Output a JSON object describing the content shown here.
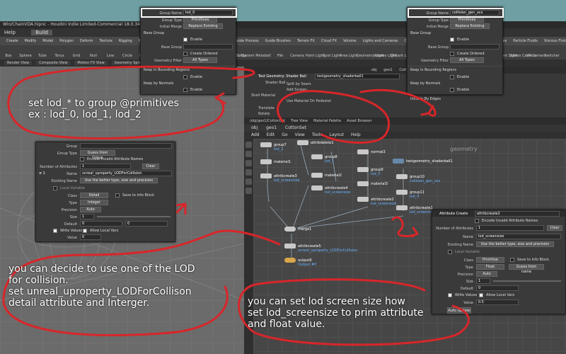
{
  "window": {
    "title": "Win/ChainVDA.hipnc - Houdini Indie Limited-Commercial 18.0.348",
    "menu": [
      "Help",
      "Build"
    ]
  },
  "shelf_tabs": [
    "Create",
    "Modify",
    "Model",
    "Polygon",
    "Deform",
    "Texture",
    "Rigging",
    "Muscles",
    "Characters",
    "Constraints",
    "Hair Utils",
    "Guide Process",
    "Guide Brushes",
    "Terrain FX",
    "Cloud FX",
    "Volume",
    "Lights and Cameras",
    "Collisions",
    "Particles",
    "Grains",
    "Vellum",
    "Rigid Bodies",
    "Particle Fluids",
    "Viscous Fluids",
    "Oceans",
    "Fluid Containers",
    "Populate Containers",
    "Container Tools",
    "Pyro FX",
    "Sparse Pyro FX",
    "FEM",
    "Wires",
    "Crowds",
    "Drive Simulation"
  ],
  "tool_labels": [
    "Box",
    "Sphere",
    "Tube",
    "Torus",
    "Grid",
    "Null",
    "Line",
    "Circle",
    "Curve",
    "Draw Curve",
    "Path",
    "Spray Paint",
    "Font",
    "Platonic Solids",
    "L-System",
    "Metaball",
    "File"
  ],
  "light_tools": [
    "Camera",
    "Point Light",
    "Spot Light",
    "Area Light",
    "Geometry Light",
    "Volume Light",
    "Distant Light",
    "Environment Light",
    "Sky Light",
    "GI Light",
    "Caustic Light",
    "Portal Light",
    "Ambient Light",
    "Stereo Camera",
    "VR Camera",
    "Switcher"
  ],
  "pane_tabs": [
    "Render View",
    "Composite View",
    "Motion FX View",
    "Geometry Spreadsheet",
    "Take List",
    "Performance Monitor"
  ],
  "param_header": {
    "node_type": "Test Geometry: Shader Ball",
    "node_name": "testgeometry_shaderball1",
    "rows": [
      "Shader Ball",
      "Split by Seam",
      "Add Screws",
      "Shell Material",
      "Use Material On Pedestal",
      "Translate",
      "Rotate"
    ]
  },
  "net_header_tabs": [
    "/obj/geo1/CottonSet",
    "Tree View",
    "Material Palette",
    "Asset Browser"
  ],
  "net_path": [
    "obj",
    "geo1",
    "CottonSet"
  ],
  "net_menu": [
    "Add",
    "Edit",
    "Go",
    "View",
    "Tools",
    "Layout",
    "Help"
  ],
  "top_path": [
    "obj",
    "geo1",
    "CottonSet"
  ],
  "nodes": [
    {
      "name": "group7",
      "sub": "lod_2"
    },
    {
      "name": "attribdelete1",
      "sub": ""
    },
    {
      "name": "group8",
      "sub": "lod_1"
    },
    {
      "name": "normal3",
      "sub": ""
    },
    {
      "name": "material1",
      "sub": ""
    },
    {
      "name": "material2",
      "sub": ""
    },
    {
      "name": "group9",
      "sub": "lod_0"
    },
    {
      "name": "attribcreate3",
      "sub": "lod_screensize"
    },
    {
      "name": "material3",
      "sub": ""
    },
    {
      "name": "attribcreate4",
      "sub": "lod_screensize"
    },
    {
      "name": "testgeometry_shaderball1",
      "sub": ""
    },
    {
      "name": "group10",
      "sub": "collision_gen_ucx"
    },
    {
      "name": "group11",
      "sub": "lod_4"
    },
    {
      "name": "attribcreate2",
      "sub": "lod_screensize"
    },
    {
      "name": "attribcreate1",
      "sub": "lod_screensize"
    },
    {
      "name": "merge1",
      "sub": ""
    },
    {
      "name": "attribcreate5",
      "sub": "unreal_uproperty_LODForCollision"
    },
    {
      "name": "output0",
      "sub": "Output #0"
    }
  ],
  "group_panel_left": {
    "group_name": "lod_0",
    "group_type": "Primitives",
    "initial_merge": "Replace Existing",
    "base_group": "Base Group",
    "enable": "Enable",
    "create_ordered": "Create Ordered",
    "geometry_filter": "All Types",
    "keep_bounding": "Keep in Bounding Regions",
    "keep_normals": "Keep by Normals",
    "include_by_edges": "Include by Edges",
    "labels": {
      "group_name": "Group Name",
      "group_type": "Group Type",
      "initial_merge": "Initial Merge",
      "base_group": "Base Group",
      "geometry_filter": "Geometry Filter"
    }
  },
  "group_panel_right": {
    "group_name": "collision_gen_ucx",
    "group_type": "Primitives",
    "initial_merge": "Replace Existing",
    "base_group": "Base Group",
    "enable": "Enable",
    "create_ordered": "Create Ordered",
    "geometry_filter": "All Types",
    "keep_bounding": "Keep in Bounding Regions",
    "keep_normals": "Keep by Normals",
    "include_by_edges": "Include By Edges",
    "labels": {
      "group_name": "Group Name",
      "group_type": "Group Type",
      "initial_merge": "Initial Merge",
      "base_group": "Base Group",
      "geometry_filter": "Geometry Filter"
    }
  },
  "attrib_panel_left": {
    "group": "Group",
    "group_type_label": "Group Type",
    "group_type": "Guess from Group",
    "encode": "Encode Invalid Attribute Names",
    "num_attr_label": "Number of Attributes",
    "num_attr": "1",
    "clear": "Clear",
    "name_label": "Name",
    "name": "unreal_uproperty_LODForCollision",
    "existing_label": "Existing Name",
    "existing": "Use the better type, size and precision",
    "local_var": "Local Variable",
    "class_label": "Class",
    "class": "Detail",
    "save_info": "Save to Info Block",
    "type_label": "Type",
    "type": "Integer",
    "precision_label": "Precision",
    "precision": "Auto",
    "size_label": "Size",
    "size": "1",
    "default_label": "Default",
    "default": "0",
    "write_values": "Write Values",
    "allow_local": "Allow Local Vars",
    "value_label": "Value",
    "value": "0"
  },
  "attrib_panel_right": {
    "header_type": "Attribute Create",
    "header_name": "attribcreate2",
    "encode": "Encode Invalid Attribute Names",
    "num_attr_label": "Number of Attributes",
    "num_attr": "1",
    "clear": "Clear",
    "name_label": "Name",
    "name": "lod_screensize",
    "existing_label": "Existing Name",
    "existing": "Use the better type, size and precision",
    "local_var": "Local Variable",
    "class_label": "Class",
    "class": "Primitive",
    "save_info": "Save to Info Block",
    "type_label": "Type",
    "type": "Float",
    "typeinfo": "Guess from name",
    "precision_label": "Precision",
    "precision": "Auto",
    "size_label": "Size",
    "size": "1",
    "default_label": "Default",
    "default": "0",
    "write_values": "Write Values",
    "allow_local": "Allow Local Vars",
    "value_label": "Value",
    "value": "0.5",
    "auto_update": "Auto Update"
  },
  "captions": {
    "top_left": [
      "set lod_* to group @primitives",
      "ex : lod_0, lod_1, lod_2"
    ],
    "bottom_left": [
      "you can decide to use one of the LOD",
      "for collision.",
      "set unreal_uproperty_LODForCollison",
      "detail attribute and Interger."
    ],
    "bottom_right": [
      "you can set lod screen size how",
      "set lod_screensize to prim attribute",
      "and float value."
    ]
  },
  "geometry_label": "geometry",
  "annotation_color": "#d8262a"
}
